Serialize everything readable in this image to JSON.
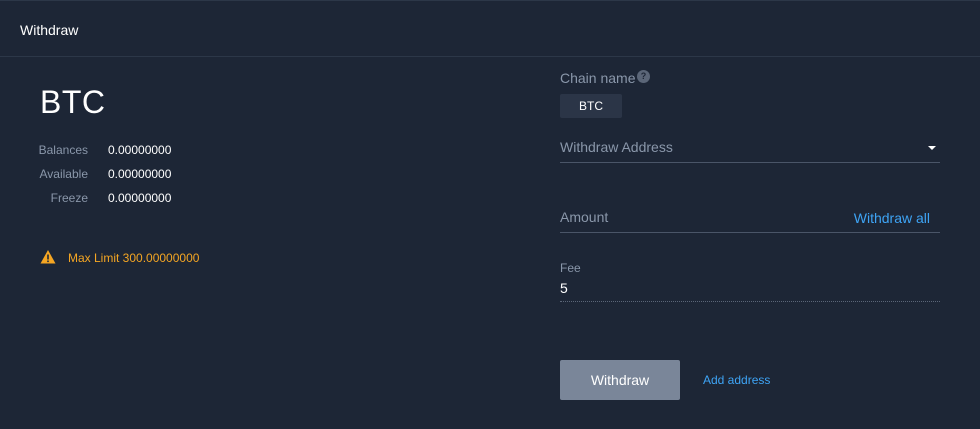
{
  "header": {
    "title": "Withdraw"
  },
  "coin": {
    "name": "BTC"
  },
  "balances": [
    {
      "label": "Balances",
      "value": "0.00000000"
    },
    {
      "label": "Available",
      "value": "0.00000000"
    },
    {
      "label": "Freeze",
      "value": "0.00000000"
    }
  ],
  "limit": {
    "text": "Max Limit 300.00000000",
    "color": "#f5a623"
  },
  "chain": {
    "label": "Chain name",
    "help_glyph": "?",
    "selected": "BTC"
  },
  "address": {
    "placeholder": "Withdraw Address"
  },
  "amount": {
    "placeholder": "Amount",
    "withdraw_all_label": "Withdraw all"
  },
  "fee": {
    "label": "Fee",
    "value": "5"
  },
  "actions": {
    "withdraw_label": "Withdraw",
    "add_address_label": "Add address"
  },
  "colors": {
    "background": "#1d2636",
    "accent": "#3ea4f5",
    "warning": "#f5a623",
    "button": "#7a8699"
  }
}
